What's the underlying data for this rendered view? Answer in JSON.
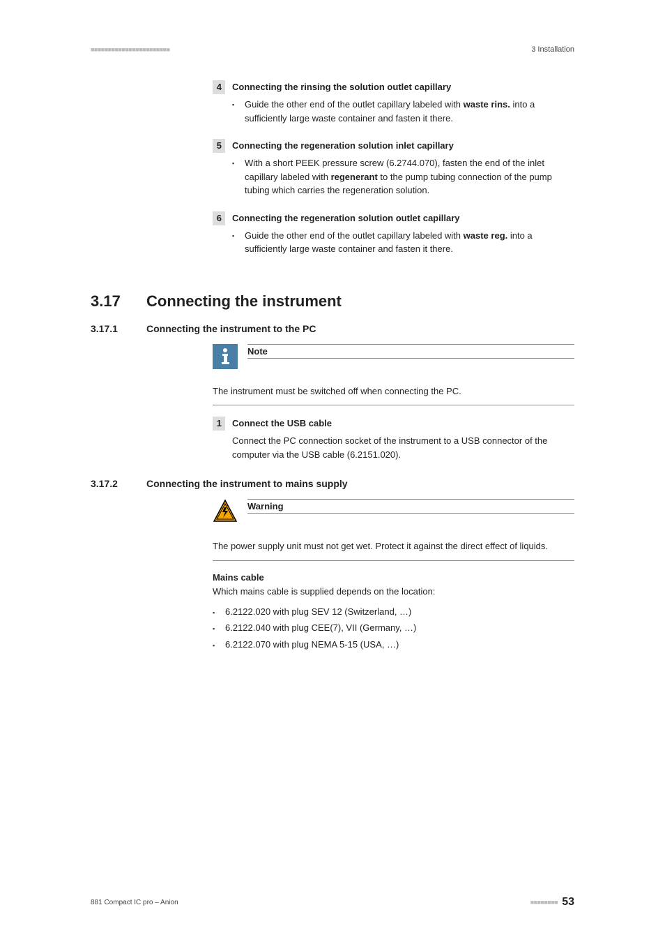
{
  "header": {
    "marks": "■■■■■■■■■■■■■■■■■■■■■■■",
    "section": "3 Installation"
  },
  "steps_top": [
    {
      "num": "4",
      "title": "Connecting the rinsing the solution outlet capillary",
      "body_pre": "Guide the other end of the outlet capillary labeled with ",
      "body_bold": "waste rins.",
      "body_post": " into a sufficiently large waste container and fasten it there."
    },
    {
      "num": "5",
      "title": "Connecting the regeneration solution inlet capillary",
      "body_pre": "With a short PEEK pressure screw (6.2744.070), fasten the end of the inlet capillary labeled with ",
      "body_bold": "regenerant",
      "body_post": " to the pump tubing connection of the pump tubing which carries the regeneration solution."
    },
    {
      "num": "6",
      "title": "Connecting the regeneration solution outlet capillary",
      "body_pre": "Guide the other end of the outlet capillary labeled with ",
      "body_bold": "waste reg.",
      "body_post": " into a sufficiently large waste container and fasten it there."
    }
  ],
  "section_main": {
    "num": "3.17",
    "title": "Connecting the instrument"
  },
  "sub1": {
    "num": "3.17.1",
    "title": "Connecting the instrument to the PC",
    "note_label": "Note",
    "note_body": "The instrument must be switched off when connecting the PC.",
    "step_num": "1",
    "step_title": "Connect the USB cable",
    "step_body": "Connect the PC connection socket of the instrument to a USB connector of the computer via the USB cable (6.2151.020)."
  },
  "sub2": {
    "num": "3.17.2",
    "title": "Connecting the instrument to mains supply",
    "warn_label": "Warning",
    "warn_body": "The power supply unit must not get wet. Protect it against the direct effect of liquids.",
    "mains_heading": "Mains cable",
    "mains_intro": "Which mains cable is supplied depends on the location:",
    "cables": [
      "6.2122.020 with plug SEV 12 (Switzerland, …)",
      "6.2122.040 with plug CEE(7), VII (Germany, …)",
      "6.2122.070 with plug NEMA 5-15 (USA, …)"
    ]
  },
  "footer": {
    "left": "881 Compact IC pro – Anion",
    "marks": "■■■■■■■■",
    "page": "53"
  }
}
